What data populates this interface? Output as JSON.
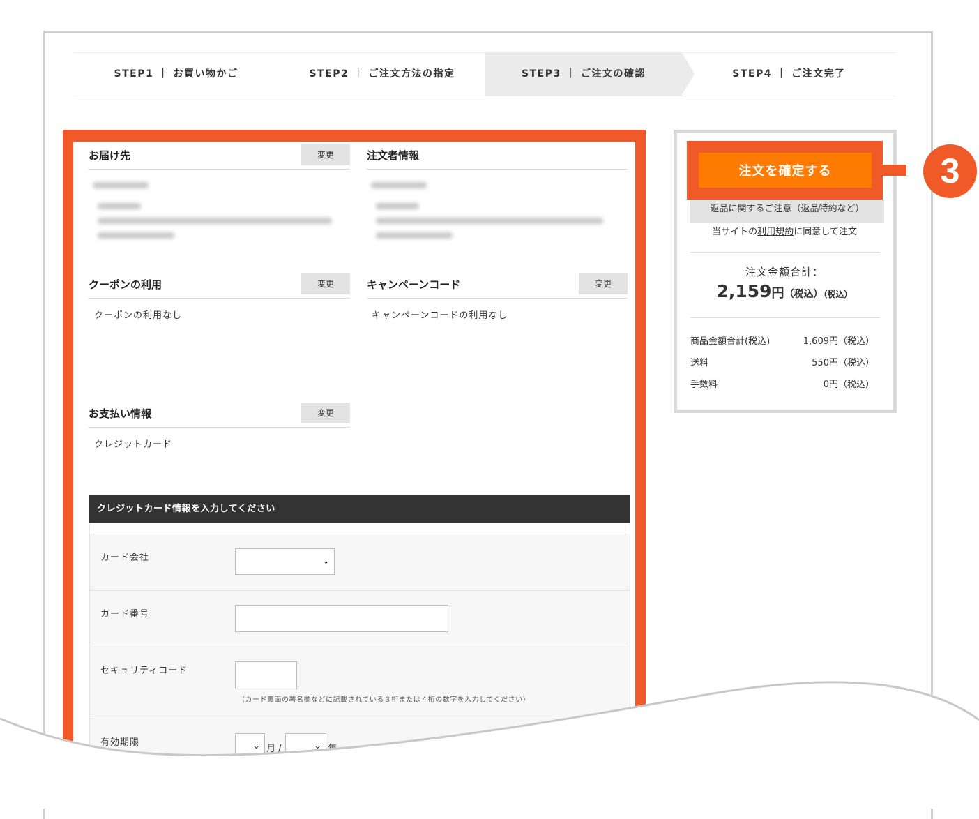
{
  "steps": [
    {
      "label": "STEP1 ｜ お買い物かご"
    },
    {
      "label": "STEP2 ｜ ご注文方法の指定"
    },
    {
      "label": "STEP3 ｜ ご注文の確認"
    },
    {
      "label": "STEP4 ｜ ご注文完了"
    }
  ],
  "change_label": "変更",
  "delivery": {
    "title": "お届け先"
  },
  "orderer": {
    "title": "注文者情報"
  },
  "coupon": {
    "title": "クーポンの利用",
    "value": "クーポンの利用なし"
  },
  "campaign": {
    "title": "キャンペーンコード",
    "value": "キャンペーンコードの利用なし"
  },
  "payment": {
    "title": "お支払い情報",
    "value": "クレジットカード"
  },
  "card_form": {
    "header": "クレジットカード情報を入力してください",
    "company_label": "カード会社",
    "number_label": "カード番号",
    "security_label": "セキュリティコード",
    "security_hint": "（カード裏面の署名欄などに記載されている３桁または４桁の数字を入力してください）",
    "expiry_label": "有効期限",
    "month_label": "月 /",
    "year_label": "年"
  },
  "summary": {
    "confirm_button": "注文を確定する",
    "returns_link": "返品に関するご注意（返品特約など）",
    "agree_prefix": "当サイトの",
    "agree_link": "利用規約",
    "agree_suffix": "に同意して注文",
    "total_label": "注文金額合計：",
    "total_amount": "2,159",
    "total_yen": "円",
    "total_tax1": "（税込）",
    "total_tax2": "（税込）",
    "lines": [
      {
        "label": "商品金額合計(税込)",
        "value": "1,609円（税込）"
      },
      {
        "label": "送料",
        "value": "550円（税込）"
      },
      {
        "label": "手数料",
        "value": "0円（税込）"
      }
    ]
  },
  "callout": {
    "number": "3"
  },
  "colors": {
    "highlight": "#f05a28",
    "confirm_button": "#ff7a00",
    "card_header": "#333333"
  }
}
